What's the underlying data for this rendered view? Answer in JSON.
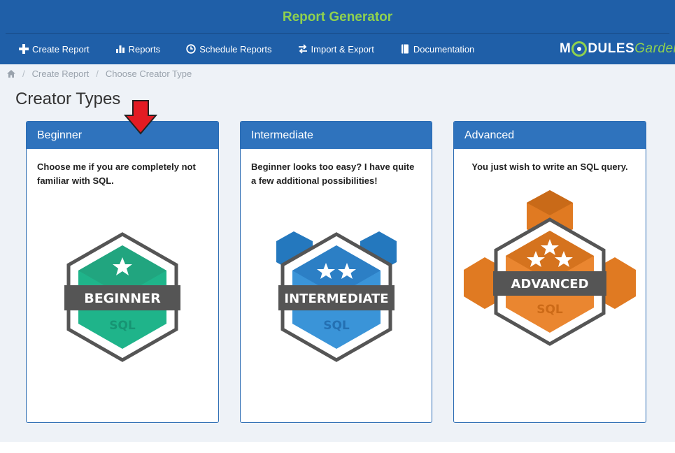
{
  "header": {
    "title": "Report Generator",
    "nav": [
      {
        "label": "Create Report",
        "icon": "plus-icon"
      },
      {
        "label": "Reports",
        "icon": "bar-chart-icon"
      },
      {
        "label": "Schedule Reports",
        "icon": "clock-icon"
      },
      {
        "label": "Import & Export",
        "icon": "exchange-icon"
      },
      {
        "label": "Documentation",
        "icon": "book-icon"
      }
    ],
    "logo": {
      "part1": "M",
      "part2": "DULES",
      "part3": "Garden"
    }
  },
  "breadcrumb": {
    "home_icon": "home-icon",
    "items": [
      "Create Report",
      "Choose Creator Type"
    ]
  },
  "page": {
    "title": "Creator Types"
  },
  "cards": [
    {
      "title": "Beginner",
      "description": "Choose me if you are completely not familiar with SQL.",
      "badge_label": "BEGINNER",
      "badge_sub": "SQL",
      "color": "#1fb48a"
    },
    {
      "title": "Intermediate",
      "description": "Beginner looks too easy? I have quite a few additional possibilities!",
      "badge_label": "INTERMEDIATE",
      "badge_sub": "SQL",
      "color": "#2f86cf"
    },
    {
      "title": "Advanced",
      "description": "You just wish to write an SQL query.",
      "badge_label": "ADVANCED",
      "badge_sub": "SQL",
      "color": "#e9832a"
    }
  ],
  "colors": {
    "header_bg": "#1f5fa8",
    "title_green": "#8fd14f",
    "card_header": "#2f73bd",
    "arrow": "#e31b23"
  }
}
